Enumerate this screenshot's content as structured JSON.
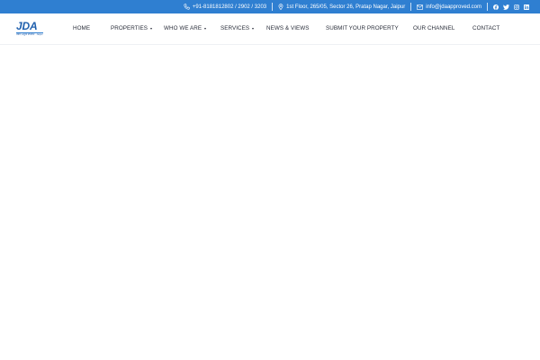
{
  "topbar": {
    "phone": "+91-8181812802 / 2902 / 3203",
    "address": "1st Floor, 265/05, Sector 26, Pratap Nagar, Jaipur",
    "email": "info@jdaapproved.com",
    "social": [
      "facebook-icon",
      "twitter-icon",
      "instagram-icon",
      "linkedin-icon"
    ],
    "bg_color": "#2f7fd1"
  },
  "logo": {
    "mark": "JDA",
    "tagline": "जेडीए अप्रूव्ड प्रॉपर्टीज़ · Jaipur"
  },
  "nav": {
    "home": "HOME",
    "properties": "PROPERTIES",
    "who_we_are": "WHO WE ARE",
    "services": "SERVICES",
    "news": "NEWS & VIEWS",
    "submit": "SUBMIT YOUR PROPERTY",
    "channel": "OUR CHANNEL",
    "contact": "CONTACT"
  }
}
